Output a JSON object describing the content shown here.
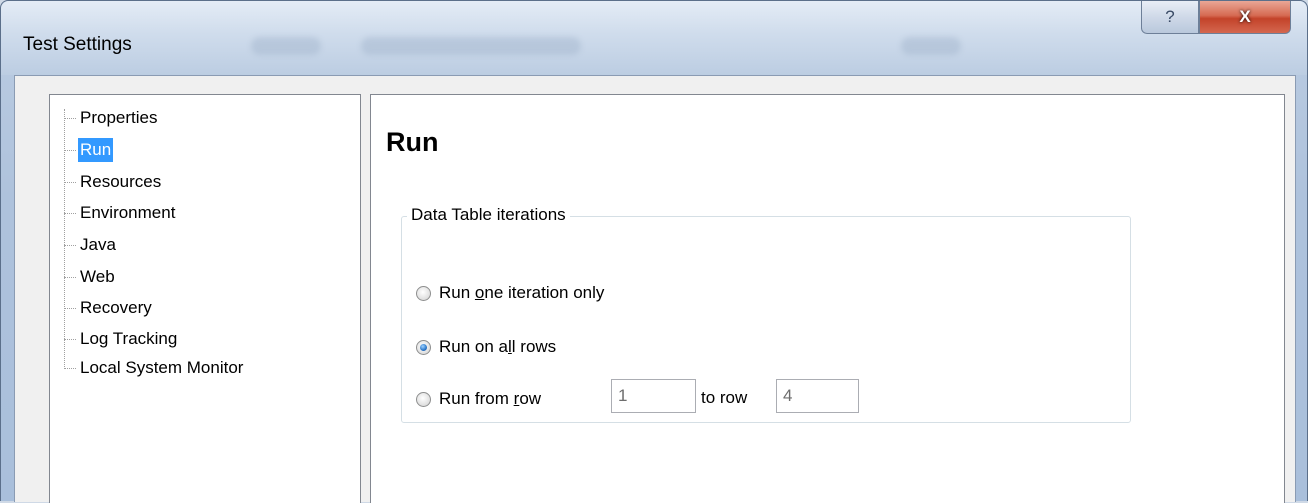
{
  "window": {
    "title": "Test Settings",
    "help_glyph": "?",
    "close_glyph": "X"
  },
  "sidebar": {
    "items": [
      {
        "label": "Properties",
        "selected": false
      },
      {
        "label": "Run",
        "selected": true
      },
      {
        "label": "Resources",
        "selected": false
      },
      {
        "label": "Environment",
        "selected": false
      },
      {
        "label": "Java",
        "selected": false
      },
      {
        "label": "Web",
        "selected": false
      },
      {
        "label": "Recovery",
        "selected": false
      },
      {
        "label": "Log Tracking",
        "selected": false
      },
      {
        "label": "Local System Monitor",
        "selected": false
      }
    ]
  },
  "main": {
    "title": "Run",
    "group": {
      "legend": "Data Table iterations",
      "options": {
        "one_iteration": {
          "pre": "Run ",
          "mnemonic": "o",
          "post": "ne iteration only",
          "checked": false
        },
        "all_rows": {
          "pre": "Run on a",
          "mnemonic": "l",
          "post": "l rows",
          "checked": true
        },
        "from_row": {
          "pre": "Run from ",
          "mnemonic": "r",
          "post": "ow",
          "checked": false
        }
      },
      "from_value": "1",
      "to_label": "to row",
      "to_value": "4"
    }
  },
  "colors": {
    "selection": "#3399ff",
    "close_button": "#c3432a"
  }
}
